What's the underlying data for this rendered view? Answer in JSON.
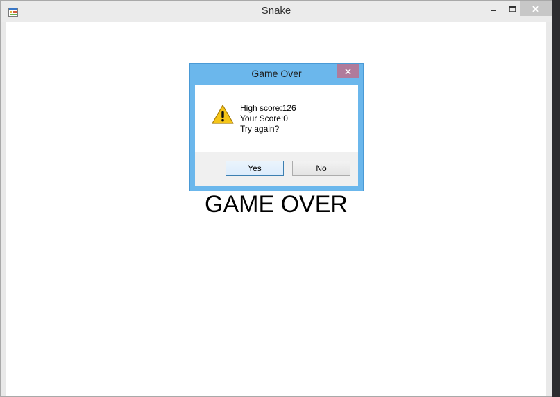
{
  "window": {
    "title": "Snake",
    "icons": {
      "app": "app-icon",
      "minimize": "minimize-icon",
      "maximize": "maximize-icon",
      "close": "close-icon"
    }
  },
  "game": {
    "status_text": "GAME OVER"
  },
  "dialog": {
    "title": "Game Over",
    "icon": "warning-icon",
    "lines": [
      "High score:126",
      "Your Score:0",
      "Try again?"
    ],
    "buttons": {
      "yes": "Yes",
      "no": "No"
    },
    "colors": {
      "frame": "#6bb7ec",
      "close": "#b07b9b",
      "default_button_border": "#3c7fb1"
    }
  }
}
